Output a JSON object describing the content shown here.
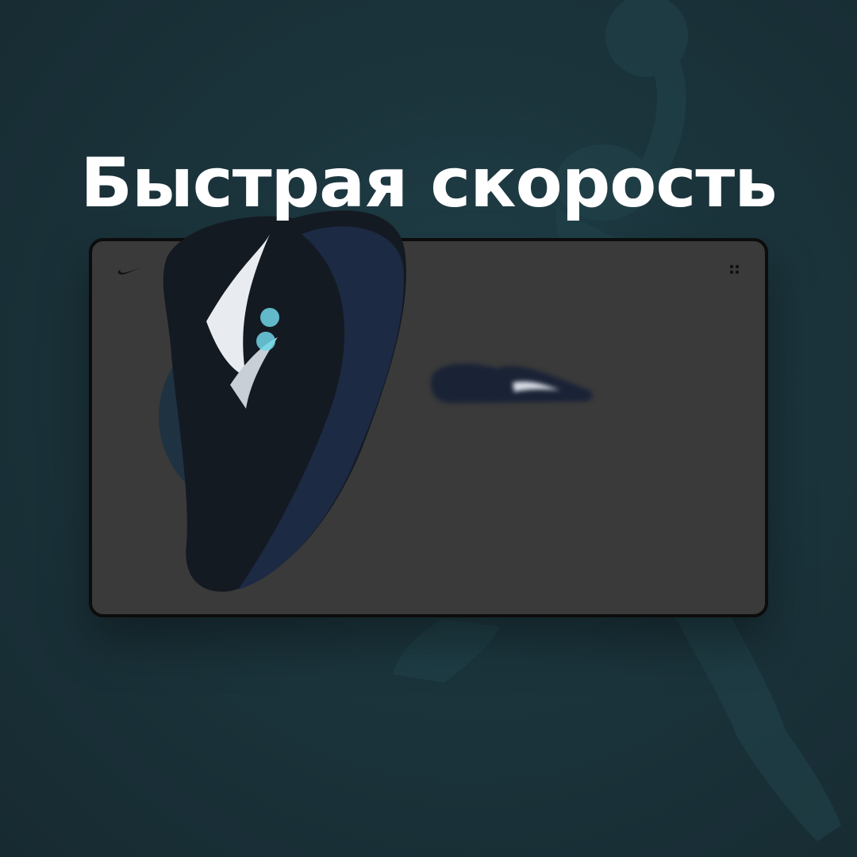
{
  "headline": {
    "text": "Быстрая скорость"
  },
  "device": {
    "brand_icon": "swoosh-logo-icon",
    "menu_icon": "grid-dots-icon"
  },
  "colors": {
    "background": "#1a2f36",
    "screen": "#3a3a3a",
    "headline": "#ffffff",
    "accent_glow": "#6fd6e8"
  }
}
